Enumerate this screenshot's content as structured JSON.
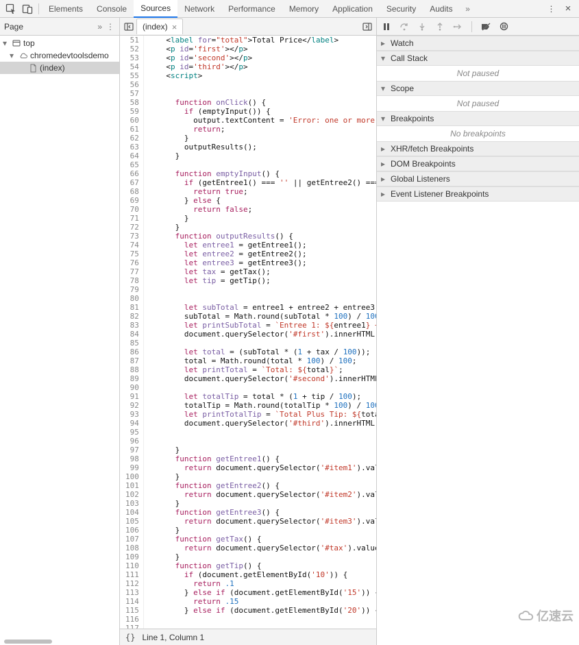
{
  "top_tabs": {
    "elements": "Elements",
    "console": "Console",
    "sources": "Sources",
    "network": "Network",
    "performance": "Performance",
    "memory": "Memory",
    "application": "Application",
    "security": "Security",
    "audits": "Audits"
  },
  "navigator": {
    "title": "Page",
    "tree": {
      "top": "top",
      "domain": "chromedevtoolsdemo",
      "file": "(index)"
    }
  },
  "source": {
    "tab_label": "(index)",
    "footer_cursor": "Line 1, Column 1",
    "code": [
      {
        "ln": 51,
        "html": "    &lt;<span class='tag'>label</span> <span class='fn'>for</span>=<span class='str'>\"total\"</span>&gt;Total Price&lt;/<span class='tag'>label</span>&gt;"
      },
      {
        "ln": 52,
        "html": "    &lt;<span class='tag'>p</span> <span class='fn'>id</span>=<span class='str'>'first'</span>&gt;&lt;/<span class='tag'>p</span>&gt;"
      },
      {
        "ln": 53,
        "html": "    &lt;<span class='tag'>p</span> <span class='fn'>id</span>=<span class='str'>'second'</span>&gt;&lt;/<span class='tag'>p</span>&gt;"
      },
      {
        "ln": 54,
        "html": "    &lt;<span class='tag'>p</span> <span class='fn'>id</span>=<span class='str'>'third'</span>&gt;&lt;/<span class='tag'>p</span>&gt;"
      },
      {
        "ln": 55,
        "html": "    &lt;<span class='tag'>script</span>&gt;"
      },
      {
        "ln": 56,
        "html": ""
      },
      {
        "ln": 57,
        "html": ""
      },
      {
        "ln": 58,
        "html": "      <span class='kw'>function</span> <span class='fn'>onClick</span>() {"
      },
      {
        "ln": 59,
        "html": "        <span class='kw'>if</span> (emptyInput()) {"
      },
      {
        "ln": 60,
        "html": "          output.textContent = <span class='str'>'Error: one or more </span>"
      },
      {
        "ln": 61,
        "html": "          <span class='kw'>return</span>;"
      },
      {
        "ln": 62,
        "html": "        }"
      },
      {
        "ln": 63,
        "html": "        outputResults();"
      },
      {
        "ln": 64,
        "html": "      }"
      },
      {
        "ln": 65,
        "html": ""
      },
      {
        "ln": 66,
        "html": "      <span class='kw'>function</span> <span class='fn'>emptyInput</span>() {"
      },
      {
        "ln": 67,
        "html": "        <span class='kw'>if</span> (getEntree1() === <span class='str'>''</span> || getEntree2() ==="
      },
      {
        "ln": 68,
        "html": "          <span class='kw'>return</span> <span class='kw'>true</span>;"
      },
      {
        "ln": 69,
        "html": "        } <span class='kw'>else</span> {"
      },
      {
        "ln": 70,
        "html": "          <span class='kw'>return</span> <span class='kw'>false</span>;"
      },
      {
        "ln": 71,
        "html": "        }"
      },
      {
        "ln": 72,
        "html": "      }"
      },
      {
        "ln": 73,
        "html": "      <span class='kw'>function</span> <span class='fn'>outputResults</span>() {"
      },
      {
        "ln": 74,
        "html": "        <span class='kw'>let</span> <span class='fn'>entree1</span> = getEntree1();"
      },
      {
        "ln": 75,
        "html": "        <span class='kw'>let</span> <span class='fn'>entree2</span> = getEntree2();"
      },
      {
        "ln": 76,
        "html": "        <span class='kw'>let</span> <span class='fn'>entree3</span> = getEntree3();"
      },
      {
        "ln": 77,
        "html": "        <span class='kw'>let</span> <span class='fn'>tax</span> = getTax();"
      },
      {
        "ln": 78,
        "html": "        <span class='kw'>let</span> <span class='fn'>tip</span> = getTip();"
      },
      {
        "ln": 79,
        "html": ""
      },
      {
        "ln": 80,
        "html": ""
      },
      {
        "ln": 81,
        "html": "        <span class='kw'>let</span> <span class='fn'>subTotal</span> = entree1 + entree2 + entree3"
      },
      {
        "ln": 82,
        "html": "        subTotal = Math.round(subTotal * <span class='num'>100</span>) / <span class='num'>100</span>"
      },
      {
        "ln": 83,
        "html": "        <span class='kw'>let</span> <span class='fn'>printSubTotal</span> = <span class='str'>`Entree 1: ${</span>entree1<span class='str'>} +</span>"
      },
      {
        "ln": 84,
        "html": "        document.querySelector(<span class='str'>'#first'</span>).innerHTML "
      },
      {
        "ln": 85,
        "html": ""
      },
      {
        "ln": 86,
        "html": "        <span class='kw'>let</span> <span class='fn'>total</span> = (subTotal * (<span class='num'>1</span> + tax / <span class='num'>100</span>));"
      },
      {
        "ln": 87,
        "html": "        total = Math.round(total * <span class='num'>100</span>) / <span class='num'>100</span>;"
      },
      {
        "ln": 88,
        "html": "        <span class='kw'>let</span> <span class='fn'>printTotal</span> = <span class='str'>`Total: ${</span>total<span class='str'>}`</span>;"
      },
      {
        "ln": 89,
        "html": "        document.querySelector(<span class='str'>'#second'</span>).innerHTML"
      },
      {
        "ln": 90,
        "html": ""
      },
      {
        "ln": 91,
        "html": "        <span class='kw'>let</span> <span class='fn'>totalTip</span> = total * (<span class='num'>1</span> + tip / <span class='num'>100</span>);"
      },
      {
        "ln": 92,
        "html": "        totalTip = Math.round(totalTip * <span class='num'>100</span>) / <span class='num'>100</span>"
      },
      {
        "ln": 93,
        "html": "        <span class='kw'>let</span> <span class='fn'>printTotalTip</span> = <span class='str'>`Total Plus Tip: ${</span>tota"
      },
      {
        "ln": 94,
        "html": "        document.querySelector(<span class='str'>'#third'</span>).innerHTML "
      },
      {
        "ln": 95,
        "html": ""
      },
      {
        "ln": 96,
        "html": ""
      },
      {
        "ln": 97,
        "html": "      }"
      },
      {
        "ln": 98,
        "html": "      <span class='kw'>function</span> <span class='fn'>getEntree1</span>() {"
      },
      {
        "ln": 99,
        "html": "        <span class='kw'>return</span> document.querySelector(<span class='str'>'#item1'</span>).val"
      },
      {
        "ln": 100,
        "html": "      }"
      },
      {
        "ln": 101,
        "html": "      <span class='kw'>function</span> <span class='fn'>getEntree2</span>() {"
      },
      {
        "ln": 102,
        "html": "        <span class='kw'>return</span> document.querySelector(<span class='str'>'#item2'</span>).val"
      },
      {
        "ln": 103,
        "html": "      }"
      },
      {
        "ln": 104,
        "html": "      <span class='kw'>function</span> <span class='fn'>getEntree3</span>() {"
      },
      {
        "ln": 105,
        "html": "        <span class='kw'>return</span> document.querySelector(<span class='str'>'#item3'</span>).val"
      },
      {
        "ln": 106,
        "html": "      }"
      },
      {
        "ln": 107,
        "html": "      <span class='kw'>function</span> <span class='fn'>getTax</span>() {"
      },
      {
        "ln": 108,
        "html": "        <span class='kw'>return</span> document.querySelector(<span class='str'>'#tax'</span>).value"
      },
      {
        "ln": 109,
        "html": "      }"
      },
      {
        "ln": 110,
        "html": "      <span class='kw'>function</span> <span class='fn'>getTip</span>() {"
      },
      {
        "ln": 111,
        "html": "        <span class='kw'>if</span> (document.getElementById(<span class='str'>'10'</span>)) {"
      },
      {
        "ln": 112,
        "html": "          <span class='kw'>return</span> <span class='num'>.1</span>"
      },
      {
        "ln": 113,
        "html": "        } <span class='kw'>else if</span> (document.getElementById(<span class='str'>'15'</span>)) {"
      },
      {
        "ln": 114,
        "html": "          <span class='kw'>return</span> <span class='num'>.15</span>"
      },
      {
        "ln": 115,
        "html": "        } <span class='kw'>else if</span> (document.getElementById(<span class='str'>'20'</span>)) {"
      },
      {
        "ln": 116,
        "html": "          "
      },
      {
        "ln": 117,
        "html": ""
      }
    ]
  },
  "debugger": {
    "panels": {
      "watch": "Watch",
      "call_stack": "Call Stack",
      "call_stack_msg": "Not paused",
      "scope": "Scope",
      "scope_msg": "Not paused",
      "breakpoints": "Breakpoints",
      "breakpoints_msg": "No breakpoints",
      "xhr": "XHR/fetch Breakpoints",
      "dom": "DOM Breakpoints",
      "global": "Global Listeners",
      "event": "Event Listener Breakpoints"
    }
  },
  "watermark": "亿速云"
}
